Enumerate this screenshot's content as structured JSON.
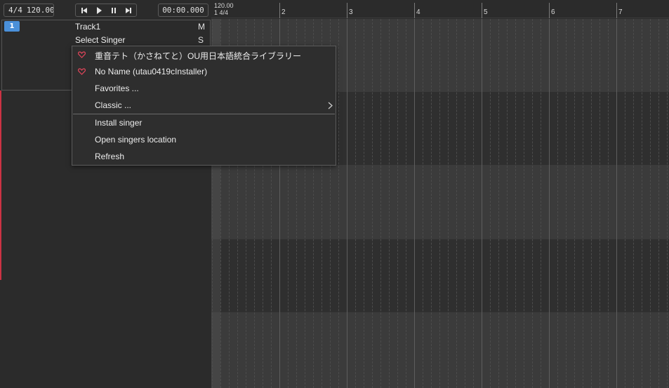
{
  "toolbar": {
    "time_signature": "4/4",
    "tempo": "120.00",
    "time_display": "00:00.000",
    "buttons": [
      "skip-back-icon",
      "play-icon",
      "pause-icon",
      "skip-forward-icon"
    ]
  },
  "track": {
    "number": "1",
    "name": "Track1",
    "mute": "M",
    "singer_label": "Select Singer",
    "solo": "S"
  },
  "ruler": {
    "tempo": "120.00",
    "time_signature": "1 4/4",
    "bars": [
      "2",
      "3",
      "4",
      "5",
      "6",
      "7"
    ]
  },
  "singer_menu": {
    "items": [
      {
        "label": "重音テト（かさねてと）OU用日本語統合ライブラリー",
        "favorite": true
      },
      {
        "label": "No Name (utau0419cInstaller)",
        "favorite": true
      },
      {
        "label": "Favorites ..."
      },
      {
        "label": "Classic ...",
        "submenu": true
      },
      {
        "label": "Install singer"
      },
      {
        "label": "Open singers location"
      },
      {
        "label": "Refresh"
      }
    ]
  },
  "colors": {
    "accent": "#4a90d9",
    "favorite_heart": "#e0455a",
    "lane_light": "#3b3b3b",
    "lane_dark": "#2f2f2f"
  }
}
